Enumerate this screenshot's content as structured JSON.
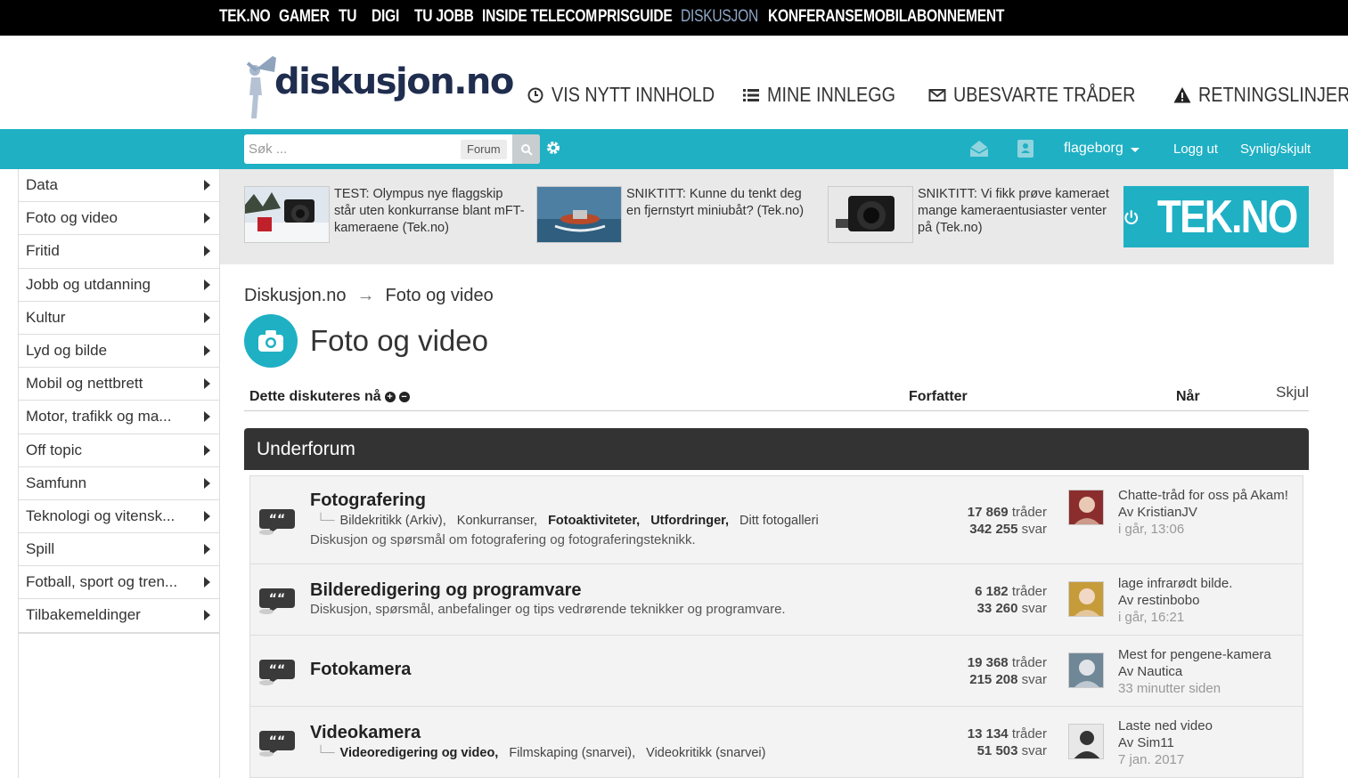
{
  "network": {
    "items": [
      "TEK.NO",
      "GAMER",
      "TU",
      "DIGI",
      "TU JOBB",
      "INSIDE TELECOM",
      "PRISGUIDE",
      "DISKUSJON",
      "KONFERANSE",
      "MOBILABONNEMENT"
    ],
    "active": "DISKUSJON"
  },
  "header": {
    "logo_text": "diskusjon.no",
    "nav": {
      "new_content": "VIS NYTT INNHOLD",
      "my_posts": "MINE INNLEGG",
      "unanswered": "UBESVARTE TRÅDER",
      "guidelines": "RETNINGSLINJER"
    }
  },
  "toolbar": {
    "search_placeholder": "Søk ...",
    "search_scope": "Forum",
    "username": "flageborg",
    "logout": "Logg ut",
    "visibility": "Synlig/skjult"
  },
  "sidebar": {
    "items": [
      "Data",
      "Foto og video",
      "Fritid",
      "Jobb og utdanning",
      "Kultur",
      "Lyd og bilde",
      "Mobil og nettbrett",
      "Motor, trafikk og ma...",
      "Off topic",
      "Samfunn",
      "Teknologi og vitensk...",
      "Spill",
      "Fotball, sport og tren...",
      "Tilbakemeldinger"
    ]
  },
  "news": {
    "items": [
      "TEST: Olympus nye flaggskip står uten konkurranse blant mFT-kameraene (Tek.no)",
      "SNIKTITT: Kunne du tenkt deg en fjernstyrt miniubåt? (Tek.no)",
      "SNIKTITT: Vi fikk prøve kameraet mange kameraentusiaster venter på (Tek.no)"
    ],
    "brand": "TEK.NO"
  },
  "breadcrumb": {
    "root": "Diskusjon.no",
    "arrow": "→",
    "current": "Foto og video"
  },
  "page": {
    "title": "Foto og video"
  },
  "discussion_header": {
    "label": "Dette diskuteres nå",
    "author": "Forfatter",
    "when": "Når",
    "hide": "Skjul"
  },
  "subforum": {
    "heading": "Underforum",
    "forums": [
      {
        "name": "Fotografering",
        "subs": [
          {
            "label": "Bildekritikk (Arkiv),",
            "bold": false
          },
          {
            "label": "Konkurranser,",
            "bold": false
          },
          {
            "label": "Fotoaktiviteter,",
            "bold": true
          },
          {
            "label": "Utfordringer,",
            "bold": true
          },
          {
            "label": "Ditt fotogalleri",
            "bold": false
          }
        ],
        "desc": "Diskusjon og spørsmål om fotografering og fotograferingsteknikk.",
        "threads": "17 869",
        "replies": "342 255",
        "last_title": "Chatte-tråd for oss på Akam!",
        "last_by": "Av KristianJV",
        "last_when": "i går, 13:06"
      },
      {
        "name": "Bilderedigering og programvare",
        "subs": [],
        "desc": "Diskusjon, spørsmål, anbefalinger og tips vedrørende teknikker og programvare.",
        "threads": "6 182",
        "replies": "33 260",
        "last_title": "lage infrarødt bilde.",
        "last_by": "Av restinbobo",
        "last_when": "i går, 16:21"
      },
      {
        "name": "Fotokamera",
        "subs": [],
        "desc": "",
        "threads": "19 368",
        "replies": "215 208",
        "last_title": "Mest for pengene-kamera",
        "last_by": "Av Nautica",
        "last_when": "33 minutter siden"
      },
      {
        "name": "Videokamera",
        "subs": [
          {
            "label": "Videoredigering og video,",
            "bold": true
          },
          {
            "label": "Filmskaping (snarvei),",
            "bold": false
          },
          {
            "label": "Videokritikk (snarvei)",
            "bold": false
          }
        ],
        "desc": "",
        "threads": "13 134",
        "replies": "51 503",
        "last_title": "Laste ned video",
        "last_by": "Av Sim11",
        "last_when": "7 jan. 2017"
      }
    ],
    "threads_word": "tråder",
    "replies_word": "svar"
  },
  "colors": {
    "accent": "#1fb0c4",
    "dark": "#333333",
    "network_active": "#8fa7c4"
  }
}
